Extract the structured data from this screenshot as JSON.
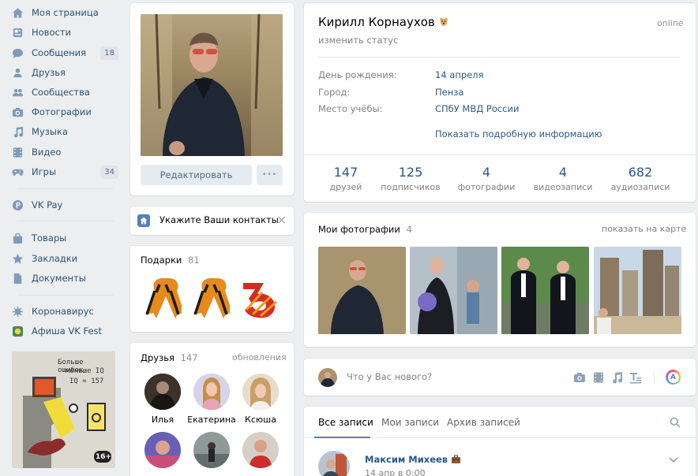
{
  "nav": {
    "items": [
      {
        "label": "Моя страница",
        "icon": "home-icon"
      },
      {
        "label": "Новости",
        "icon": "news-icon"
      },
      {
        "label": "Сообщения",
        "icon": "messages-icon",
        "count": "18"
      },
      {
        "label": "Друзья",
        "icon": "friends-icon"
      },
      {
        "label": "Сообщества",
        "icon": "groups-icon"
      },
      {
        "label": "Фотографии",
        "icon": "camera-icon"
      },
      {
        "label": "Музыка",
        "icon": "music-icon"
      },
      {
        "label": "Видео",
        "icon": "video-icon"
      },
      {
        "label": "Игры",
        "icon": "games-icon",
        "count": "34"
      }
    ],
    "vkpay": "VK Pay",
    "shop_items": [
      "Товары",
      "Закладки",
      "Документы"
    ],
    "extra_items": [
      "Коронавирус",
      "Афиша VK Fest"
    ],
    "ad_text_1": "Больше ошибок-",
    "ad_text_2": "меньше IQ",
    "ad_text_3": "IQ = 157",
    "ad_badge": "16+"
  },
  "profile": {
    "edit_label": "Редактировать",
    "more_label": "•••",
    "contacts_label": "Укажите Ваши контакты",
    "contacts_close": "×"
  },
  "gifts": {
    "title": "Подарки",
    "count": "81"
  },
  "friends_block": {
    "title": "Друзья",
    "count": "147",
    "updates_label": "обновления",
    "names": [
      "Илья",
      "Екатерина",
      "Ксюша"
    ]
  },
  "info": {
    "name": "Кирилл Корнаухов",
    "online": "online",
    "status_label": "изменить статус",
    "rows": [
      {
        "label": "День рождения:",
        "value": "14 апреля"
      },
      {
        "label": "Город:",
        "value": "Пенза"
      },
      {
        "label": "Место учёбы:",
        "value": "СПбУ МВД России"
      }
    ],
    "more_info": "Показать подробную информацию",
    "stats": [
      {
        "num": "147",
        "label": "друзей"
      },
      {
        "num": "125",
        "label": "подписчиков"
      },
      {
        "num": "4",
        "label": "фотографии"
      },
      {
        "num": "4",
        "label": "видеозаписи"
      },
      {
        "num": "682",
        "label": "аудиозаписи"
      }
    ]
  },
  "photos": {
    "title": "Мои фотографии",
    "count": "4",
    "map_link": "показать на карте"
  },
  "composer": {
    "placeholder": "Что у Вас нового?"
  },
  "wall": {
    "tabs": [
      "Все записи",
      "Мои записи",
      "Архив записей"
    ],
    "post_author": "Максим Михеев",
    "post_date": "14 апр в 0:00"
  },
  "colors": {
    "link": "#2a5885",
    "bg": "#edeef0",
    "accent": "#5181b8"
  }
}
